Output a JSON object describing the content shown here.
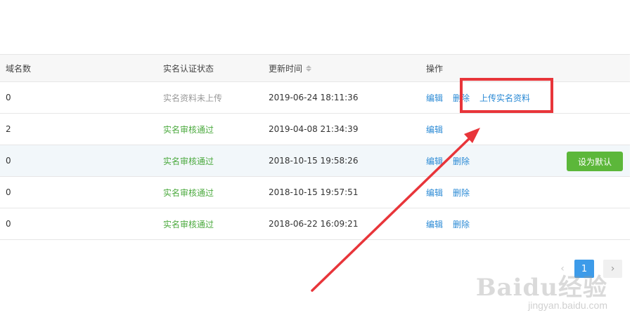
{
  "table": {
    "headers": {
      "domain_count": "域名数",
      "verify_status": "实名认证状态",
      "update_time": "更新时间",
      "actions": "操作"
    },
    "rows": [
      {
        "count": "0",
        "status": "实名资料未上传",
        "status_type": "pending",
        "time": "2019-06-24 18:11:36",
        "edit": "编辑",
        "delete": "删除",
        "upload": "上传实名资料"
      },
      {
        "count": "2",
        "status": "实名审核通过",
        "status_type": "ok",
        "time": "2019-04-08 21:34:39",
        "edit": "编辑"
      },
      {
        "count": "0",
        "status": "实名审核通过",
        "status_type": "ok",
        "time": "2018-10-15 19:58:26",
        "edit": "编辑",
        "delete": "删除",
        "set_default": "设为默认"
      },
      {
        "count": "0",
        "status": "实名审核通过",
        "status_type": "ok",
        "time": "2018-10-15 19:57:51",
        "edit": "编辑",
        "delete": "删除"
      },
      {
        "count": "0",
        "status": "实名审核通过",
        "status_type": "ok",
        "time": "2018-06-22 16:09:21",
        "edit": "编辑",
        "delete": "删除"
      }
    ]
  },
  "pagination": {
    "current": "1",
    "prev": "‹",
    "next": "›"
  },
  "watermark": {
    "logo": "Baidu经验",
    "url": "jingyan.baidu.com"
  },
  "colors": {
    "link": "#2b8ad5",
    "ok_status": "#4caa3f",
    "default_button": "#5cb73a",
    "annotation_red": "#e8353a",
    "page_active": "#3d9be9"
  }
}
